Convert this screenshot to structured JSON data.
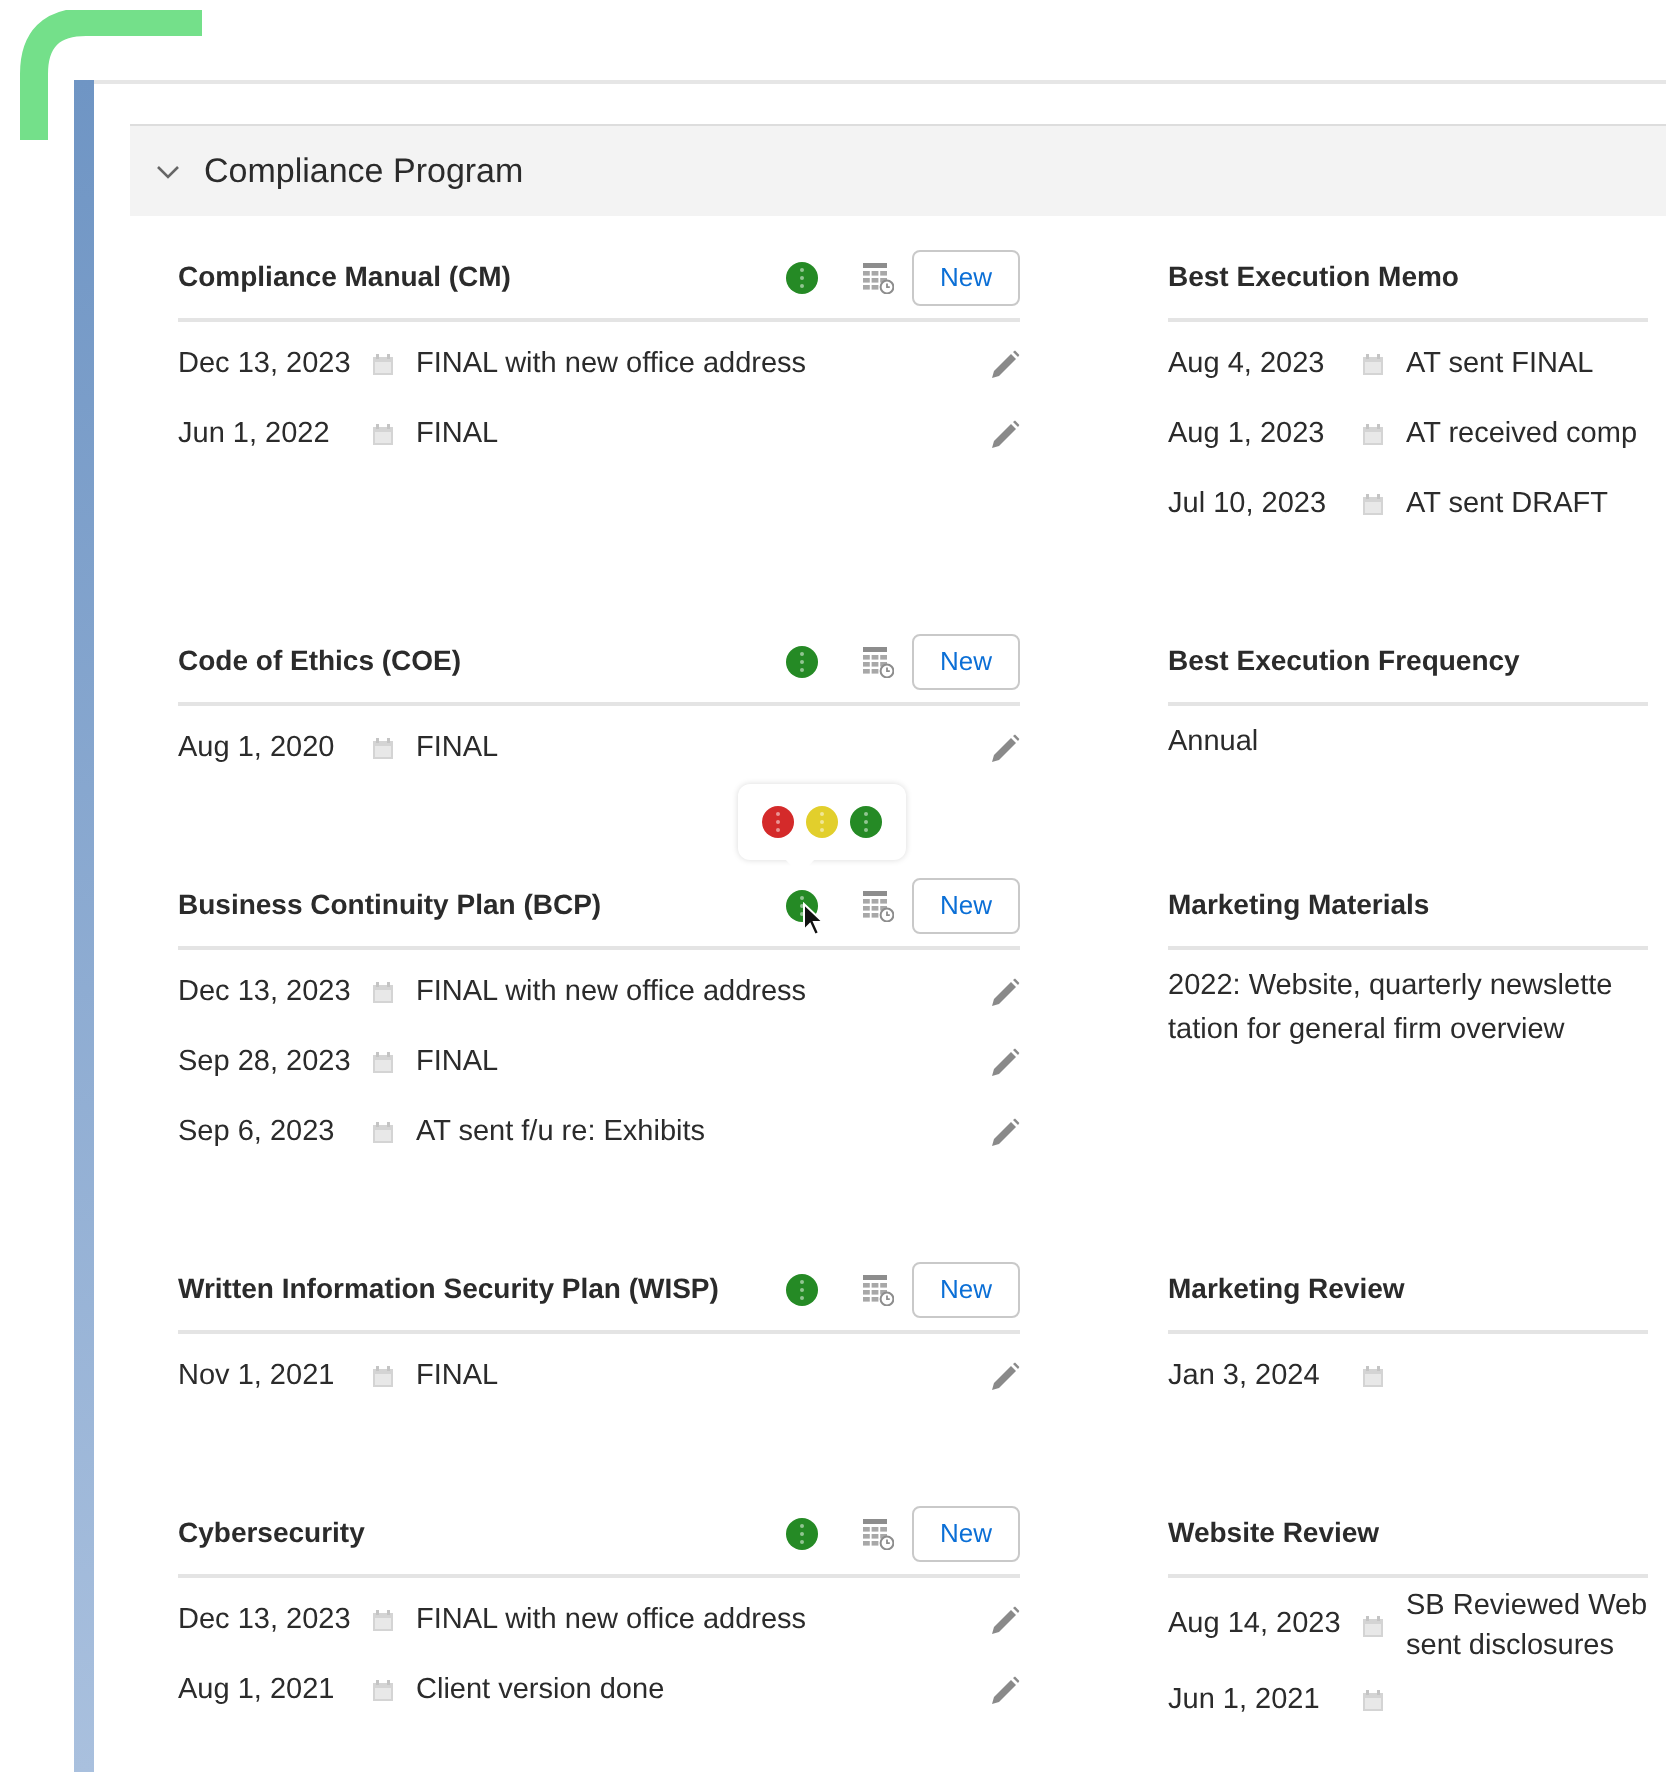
{
  "section": {
    "title": "Compliance Program",
    "expanded": true
  },
  "card_rows": [
    {
      "cards": [
        {
          "kind": "log",
          "title": "Compliance Manual (CM)",
          "status": {
            "color": "#258a25",
            "menu_open": false
          },
          "new_button": "New",
          "entries": [
            {
              "date": "Dec 13, 2023",
              "note": "FINAL with new office address",
              "editable": true
            },
            {
              "date": "Jun 1, 2022",
              "note": "FINAL",
              "editable": true
            }
          ]
        },
        {
          "kind": "log",
          "title": "Best Execution Memo",
          "entries": [
            {
              "date": "Aug 4, 2023",
              "note": "AT sent FINAL"
            },
            {
              "date": "Aug 1, 2023",
              "note": "AT received comp"
            },
            {
              "date": "Jul 10, 2023",
              "note": "AT sent DRAFT"
            }
          ]
        }
      ]
    },
    {
      "cards": [
        {
          "kind": "log",
          "title": "Code of Ethics (COE)",
          "status": {
            "color": "#258a25",
            "menu_open": false
          },
          "new_button": "New",
          "entries": [
            {
              "date": "Aug 1, 2020",
              "note": "FINAL",
              "editable": true
            }
          ]
        },
        {
          "kind": "text",
          "title": "Best Execution Frequency",
          "lines": [
            "Annual"
          ]
        }
      ]
    },
    {
      "cards": [
        {
          "kind": "log",
          "title": "Business Continuity Plan (BCP)",
          "status": {
            "color": "#258a25",
            "menu_open": true,
            "options": [
              {
                "color": "#d42a2a"
              },
              {
                "color": "#e2cf2c"
              },
              {
                "color": "#258a25"
              }
            ]
          },
          "new_button": "New",
          "entries": [
            {
              "date": "Dec 13, 2023",
              "note": "FINAL with new office address",
              "editable": true
            },
            {
              "date": "Sep 28, 2023",
              "note": "FINAL",
              "editable": true
            },
            {
              "date": "Sep 6, 2023",
              "note": "AT sent f/u re: Exhibits",
              "editable": true
            }
          ]
        },
        {
          "kind": "text",
          "title": "Marketing Materials",
          "lines": [
            "2022: Website, quarterly newslette",
            "tation for general firm overview"
          ]
        }
      ]
    },
    {
      "cards": [
        {
          "kind": "log",
          "title": "Written Information Security Plan (WISP)",
          "status": {
            "color": "#258a25",
            "menu_open": false
          },
          "new_button": "New",
          "entries": [
            {
              "date": "Nov 1, 2021",
              "note": "FINAL",
              "editable": true
            }
          ]
        },
        {
          "kind": "log",
          "title": "Marketing Review",
          "entries": [
            {
              "date": "Jan 3, 2024"
            }
          ]
        }
      ]
    },
    {
      "cards": [
        {
          "kind": "log",
          "title": "Cybersecurity",
          "status": {
            "color": "#258a25",
            "menu_open": false
          },
          "new_button": "New",
          "entries": [
            {
              "date": "Dec 13, 2023",
              "note": "FINAL with new office address",
              "editable": true
            },
            {
              "date": "Aug 1, 2021",
              "note": "Client version done",
              "editable": true
            }
          ]
        },
        {
          "kind": "log",
          "title": "Website Review",
          "entries": [
            {
              "date": "Aug 14, 2023",
              "note_lines": [
                "SB Reviewed Web",
                "sent disclosures"
              ]
            },
            {
              "date": "Jun 1, 2021"
            }
          ]
        }
      ]
    }
  ]
}
